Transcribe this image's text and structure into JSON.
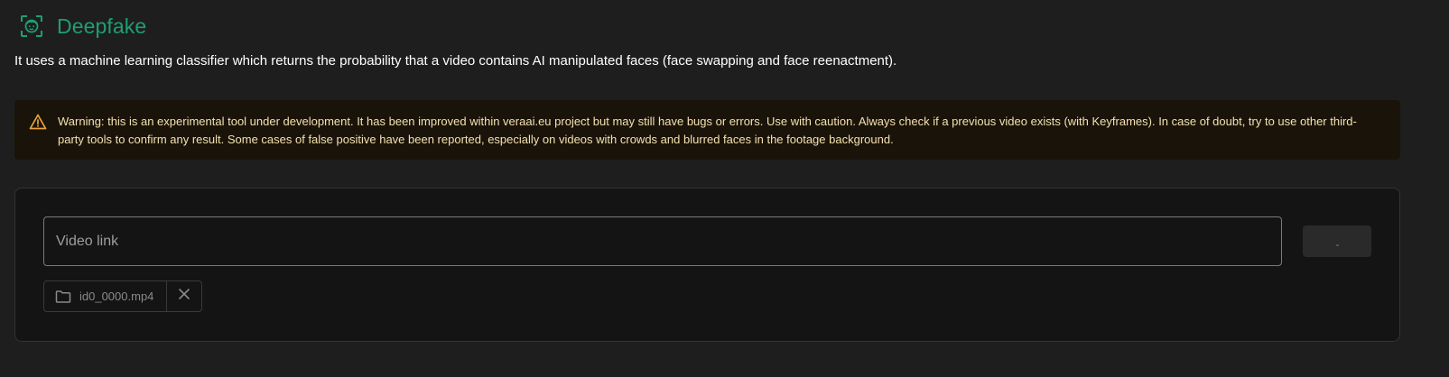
{
  "header": {
    "icon": "face-scan-icon",
    "title": "Deepfake"
  },
  "description": "It uses a machine learning classifier which returns the probability that a video contains AI manipulated faces (face swapping and face reenactment).",
  "warning": {
    "icon": "warning-triangle-icon",
    "text": "Warning: this is an experimental tool under development. It has been improved within veraai.eu project but may still have bugs or errors. Use with caution. Always check if a previous video exists (with Keyframes). In case of doubt, try to use other third-party tools to confirm any result. Some cases of false positive have been reported, especially on videos with crowds and blurred faces in the footage background."
  },
  "form": {
    "video_link_placeholder": "Video link",
    "video_link_value": "",
    "submit_state": "loading",
    "file": {
      "icon": "folder-icon",
      "name": "id0_0000.mp4",
      "remove_icon": "close-icon"
    }
  },
  "colors": {
    "background": "#1e1e1e",
    "accent": "#1f9e75",
    "warning_icon": "#e8a33d",
    "warning_text": "#f3e0b0",
    "warning_bg": "#1a1309"
  }
}
